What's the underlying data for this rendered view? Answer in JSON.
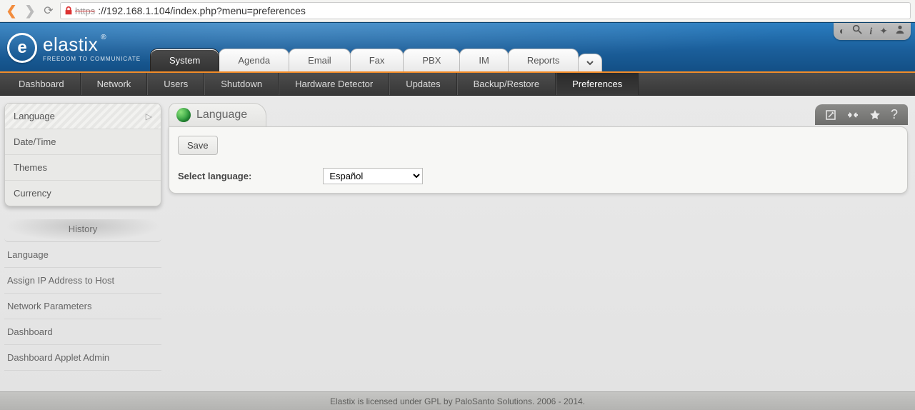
{
  "browser": {
    "https_label": "https",
    "url": "://192.168.1.104/index.php?menu=preferences"
  },
  "brand": {
    "name": "elastix",
    "trademark": "®",
    "tagline": "FREEDOM TO COMMUNICATE"
  },
  "main_tabs": [
    "System",
    "Agenda",
    "Email",
    "Fax",
    "PBX",
    "IM",
    "Reports"
  ],
  "main_tabs_active_index": 0,
  "secnav": [
    "Dashboard",
    "Network",
    "Users",
    "Shutdown",
    "Hardware Detector",
    "Updates",
    "Backup/Restore",
    "Preferences"
  ],
  "secnav_active_index": 7,
  "sidebar": {
    "items": [
      "Language",
      "Date/Time",
      "Themes",
      "Currency"
    ],
    "active_index": 0,
    "history_title": "History",
    "history": [
      "Language",
      "Assign IP Address to Host",
      "Network Parameters",
      "Dashboard",
      "Dashboard Applet Admin"
    ]
  },
  "panel": {
    "title": "Language",
    "save_label": "Save",
    "form": {
      "select_language_label": "Select language:",
      "selected": "Español",
      "options": [
        "Español"
      ]
    }
  },
  "footer": "Elastix is licensed under GPL by PaloSanto Solutions. 2006 - 2014."
}
